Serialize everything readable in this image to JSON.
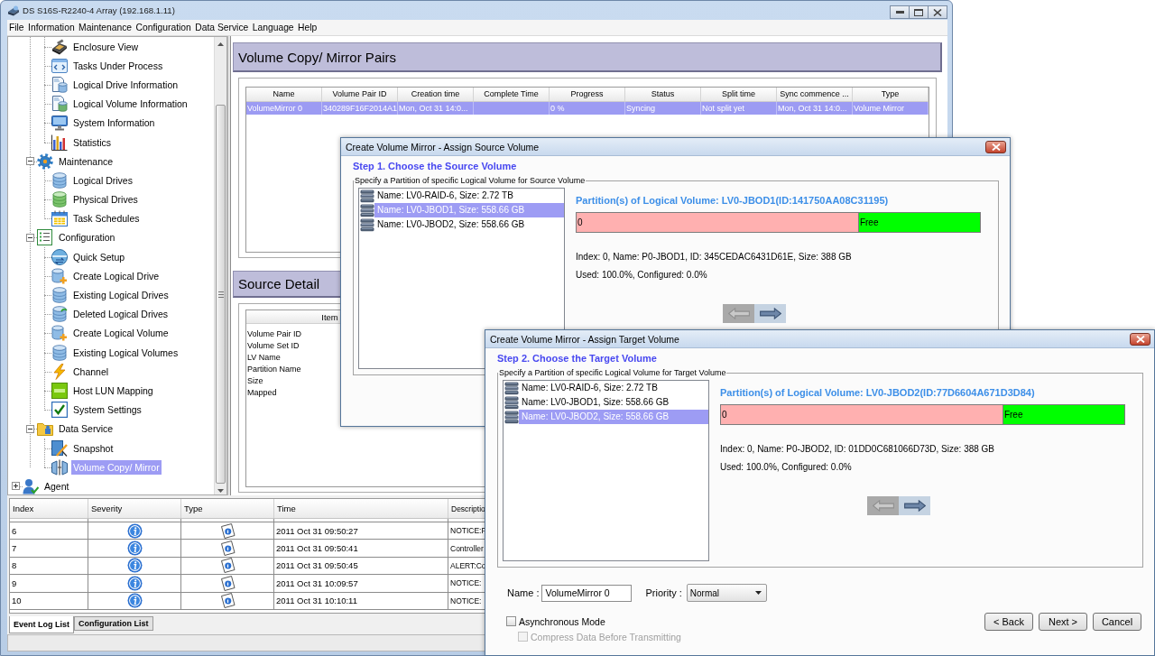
{
  "window": {
    "title": "DS S16S-R2240-4 Array (192.168.1.11)"
  },
  "menu": [
    "File",
    "Information",
    "Maintenance",
    "Configuration",
    "Data Service",
    "Language",
    "Help"
  ],
  "sidebar": {
    "tree": [
      {
        "children": [
          {
            "children": [
              {
                "label": "Enclosure View",
                "selected": false
              },
              {
                "label": "Tasks Under Process",
                "selected": false
              },
              {
                "label": "Logical Drive Information",
                "selected": false
              },
              {
                "label": "Logical Volume Information",
                "selected": false
              },
              {
                "label": "System Information",
                "selected": false
              },
              {
                "label": "Statistics",
                "selected": false
              }
            ]
          },
          {
            "label": "Maintenance",
            "selected": false,
            "expanded": true,
            "children": [
              {
                "label": "Logical Drives",
                "selected": false
              },
              {
                "label": "Physical Drives",
                "selected": false
              },
              {
                "label": "Task Schedules",
                "selected": false
              }
            ]
          },
          {
            "label": "Configuration",
            "selected": false,
            "expanded": true,
            "children": [
              {
                "label": "Quick Setup",
                "selected": false
              },
              {
                "label": "Create Logical Drive",
                "selected": false
              },
              {
                "label": "Existing Logical Drives",
                "selected": false
              },
              {
                "label": "Deleted Logical Drives",
                "selected": false
              },
              {
                "label": "Create Logical Volume",
                "selected": false
              },
              {
                "label": "Existing Logical Volumes",
                "selected": false
              },
              {
                "label": "Channel",
                "selected": false
              },
              {
                "label": "Host LUN Mapping",
                "selected": false
              },
              {
                "label": "System Settings",
                "selected": false
              }
            ]
          },
          {
            "label": "Data Service",
            "selected": false,
            "expanded": true,
            "children": [
              {
                "label": "Snapshot",
                "selected": false
              },
              {
                "label": "Volume Copy/ Mirror",
                "selected": true
              }
            ]
          }
        ]
      },
      {
        "label": "Agent",
        "selected": false,
        "expanded": false
      }
    ]
  },
  "pairs": {
    "title": "Volume Copy/ Mirror Pairs",
    "columns": [
      "Name",
      "Volume Pair ID",
      "Creation time",
      "Complete Time",
      "Progress",
      "Status",
      "Split time",
      "Sync commence ...",
      "Type"
    ],
    "rows": [
      {
        "selected": true,
        "cells": [
          "VolumeMirror 0",
          "340289F16F2014A1",
          "Mon, Oct 31 14:0...",
          null,
          "0 %",
          "Syncing",
          "Not split yet",
          "Mon, Oct 31 14:0...",
          "Volume Mirror"
        ]
      }
    ]
  },
  "source_detail": {
    "title": "Source Detail",
    "column": "Item",
    "rows": [
      "Volume Pair ID",
      "Volume Set ID",
      "LV Name",
      "Partition Name",
      "Size",
      "Mapped"
    ]
  },
  "event_log": {
    "columns": [
      "Index",
      "Severity",
      "Type",
      "Time",
      "Descriptio"
    ],
    "rows": [
      {
        "index": "6",
        "kind": "info",
        "time": "2011 Oct 31 09:50:27",
        "description": "NOTICE:F"
      },
      {
        "index": "7",
        "kind": "info",
        "time": "2011 Oct 31 09:50:41",
        "description": "Controller"
      },
      {
        "index": "8",
        "kind": "info",
        "time": "2011 Oct 31 09:50:45",
        "description": "ALERT:Co"
      },
      {
        "index": "9",
        "kind": "info",
        "time": "2011 Oct 31 10:09:57",
        "description": "NOTICE:"
      },
      {
        "index": "10",
        "kind": "info",
        "time": "2011 Oct 31 10:10:11",
        "description": "NOTICE:"
      }
    ]
  },
  "bottom_tabs": [
    {
      "label": "Event Log List",
      "selected": true
    },
    {
      "label": "Configuration List",
      "selected": false
    }
  ],
  "dialogs": [
    {
      "title": "Create Volume Mirror - Assign Source Volume",
      "step": "Step 1. Choose the Source Volume",
      "group_title": "Specify a Partition of specific Logical Volume for Source Volume",
      "volumes": [
        {
          "label": "Name: LV0-RAID-6, Size: 2.72 TB",
          "selected": false
        },
        {
          "label": "Name: LV0-JBOD1, Size: 558.66 GB",
          "selected": true
        },
        {
          "label": "Name: LV0-JBOD2, Size: 558.66 GB",
          "selected": false
        }
      ],
      "partition_title": "Partition(s) of Logical Volume: LV0-JBOD1(ID:141750AA08C31195)",
      "segments": [
        {
          "label": "0",
          "level": 0.7,
          "color": "#ffb0b0"
        },
        {
          "label": "Free",
          "level": 0.3,
          "color": "#00ff00"
        }
      ],
      "details": [
        "Index: 0, Name: P0-JBOD1, ID: 345CEDAC6431D61E, Size: 388 GB",
        "Used: 100.0%, Configured: 0.0%"
      ],
      "arrows": [
        {
          "disabled": true
        },
        {
          "disabled": false
        }
      ]
    },
    {
      "title": "Create Volume Mirror - Assign Target Volume",
      "step": "Step 2. Choose the Target Volume",
      "group_title": "Specify a Partition of specific Logical Volume for Target Volume",
      "volumes": [
        {
          "label": "Name: LV0-RAID-6, Size: 2.72 TB",
          "selected": false
        },
        {
          "label": "Name: LV0-JBOD1, Size: 558.66 GB",
          "selected": false
        },
        {
          "label": "Name: LV0-JBOD2, Size: 558.66 GB",
          "selected": true
        }
      ],
      "partition_title": "Partition(s) of Logical Volume: LV0-JBOD2(ID:77D6604A671D3D84)",
      "segments": [
        {
          "label": "0",
          "level": 0.7,
          "color": "#ffb0b0"
        },
        {
          "label": "Free",
          "level": 0.3,
          "color": "#00ff00"
        }
      ],
      "details": [
        "Index: 0, Name: P0-JBOD2, ID: 01DD0C681066D73D, Size: 388 GB",
        "Used: 100.0%, Configured: 0.0%"
      ],
      "arrows": [
        {
          "disabled": true
        },
        {
          "disabled": false
        }
      ],
      "form": {
        "name_label": "Name :",
        "name_value": "VolumeMirror 0",
        "priority_label": "Priority :",
        "priority_value": "Normal",
        "options": [
          {
            "label": "Asynchronous Mode",
            "checked": false,
            "disabled": false,
            "children": [
              {
                "label": "Compress Data Before Transmitting",
                "checked": false,
                "disabled": true
              }
            ]
          }
        ],
        "buttons": [
          "< Back",
          "Next >",
          "Cancel"
        ]
      }
    }
  ]
}
